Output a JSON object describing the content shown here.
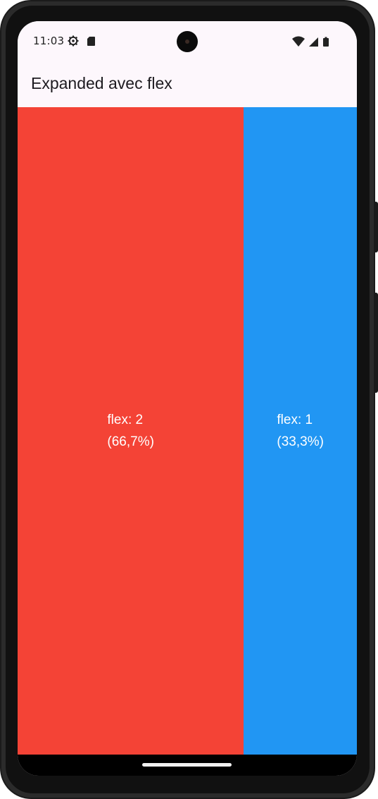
{
  "status_bar": {
    "time": "11:03",
    "left_icons": [
      "gear-icon",
      "sd-card-icon"
    ],
    "right_icons": [
      "wifi-icon",
      "signal-icon",
      "battery-icon"
    ]
  },
  "app_bar": {
    "title": "Expanded avec flex"
  },
  "boxes": [
    {
      "label": "flex: 2",
      "percent": "(66,7%)",
      "flex": 2,
      "color": "#f44336"
    },
    {
      "label": "flex: 1",
      "percent": "(33,3%)",
      "flex": 1,
      "color": "#2196f3"
    }
  ]
}
